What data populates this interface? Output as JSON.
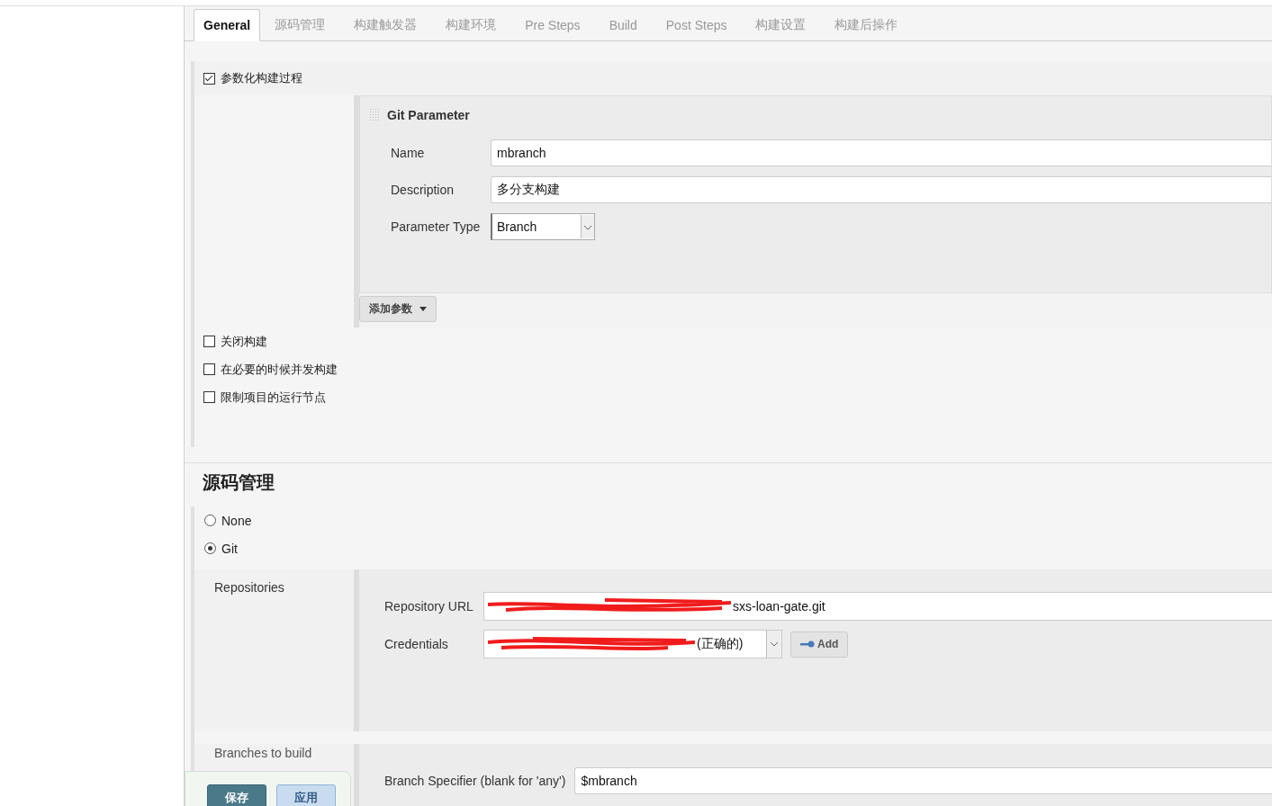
{
  "tabs": [
    {
      "label": "General",
      "selected": true
    },
    {
      "label": "源码管理",
      "selected": false
    },
    {
      "label": "构建触发器",
      "selected": false
    },
    {
      "label": "构建环境",
      "selected": false
    },
    {
      "label": "Pre Steps",
      "selected": false
    },
    {
      "label": "Build",
      "selected": false
    },
    {
      "label": "Post Steps",
      "selected": false
    },
    {
      "label": "构建设置",
      "selected": false
    },
    {
      "label": "构建后操作",
      "selected": false
    }
  ],
  "parameterized": {
    "label": "参数化构建过程",
    "checked": true
  },
  "git_parameter": {
    "title": "Git Parameter",
    "fields": [
      {
        "label": "Name",
        "value": "mbranch"
      },
      {
        "label": "Description",
        "value": "多分支构建"
      }
    ],
    "type_label": "Parameter Type",
    "type_value": "Branch"
  },
  "add_parameter_button": "添加参数",
  "options": [
    {
      "label": "关闭构建",
      "checked": false
    },
    {
      "label": "在必要的时候并发构建",
      "checked": false
    },
    {
      "label": "限制项目的运行节点",
      "checked": false
    }
  ],
  "scm": {
    "heading": "源码管理",
    "choices": [
      {
        "label": "None",
        "selected": false
      },
      {
        "label": "Git",
        "selected": true
      }
    ],
    "repositories_label": "Repositories",
    "repository_url_label": "Repository URL",
    "repository_url": "sxs-loan-gate.git",
    "credentials_label": "Credentials",
    "credentials": "(正确的)",
    "add_button": "Add",
    "branches_label": "Branches to build",
    "branch_specifier_label": "Branch Specifier (blank for 'any')",
    "branch_specifier": "$mbranch"
  },
  "footer_buttons": [
    {
      "label": "保存",
      "kind": "primary"
    },
    {
      "label": "应用",
      "kind": "secondary"
    }
  ]
}
